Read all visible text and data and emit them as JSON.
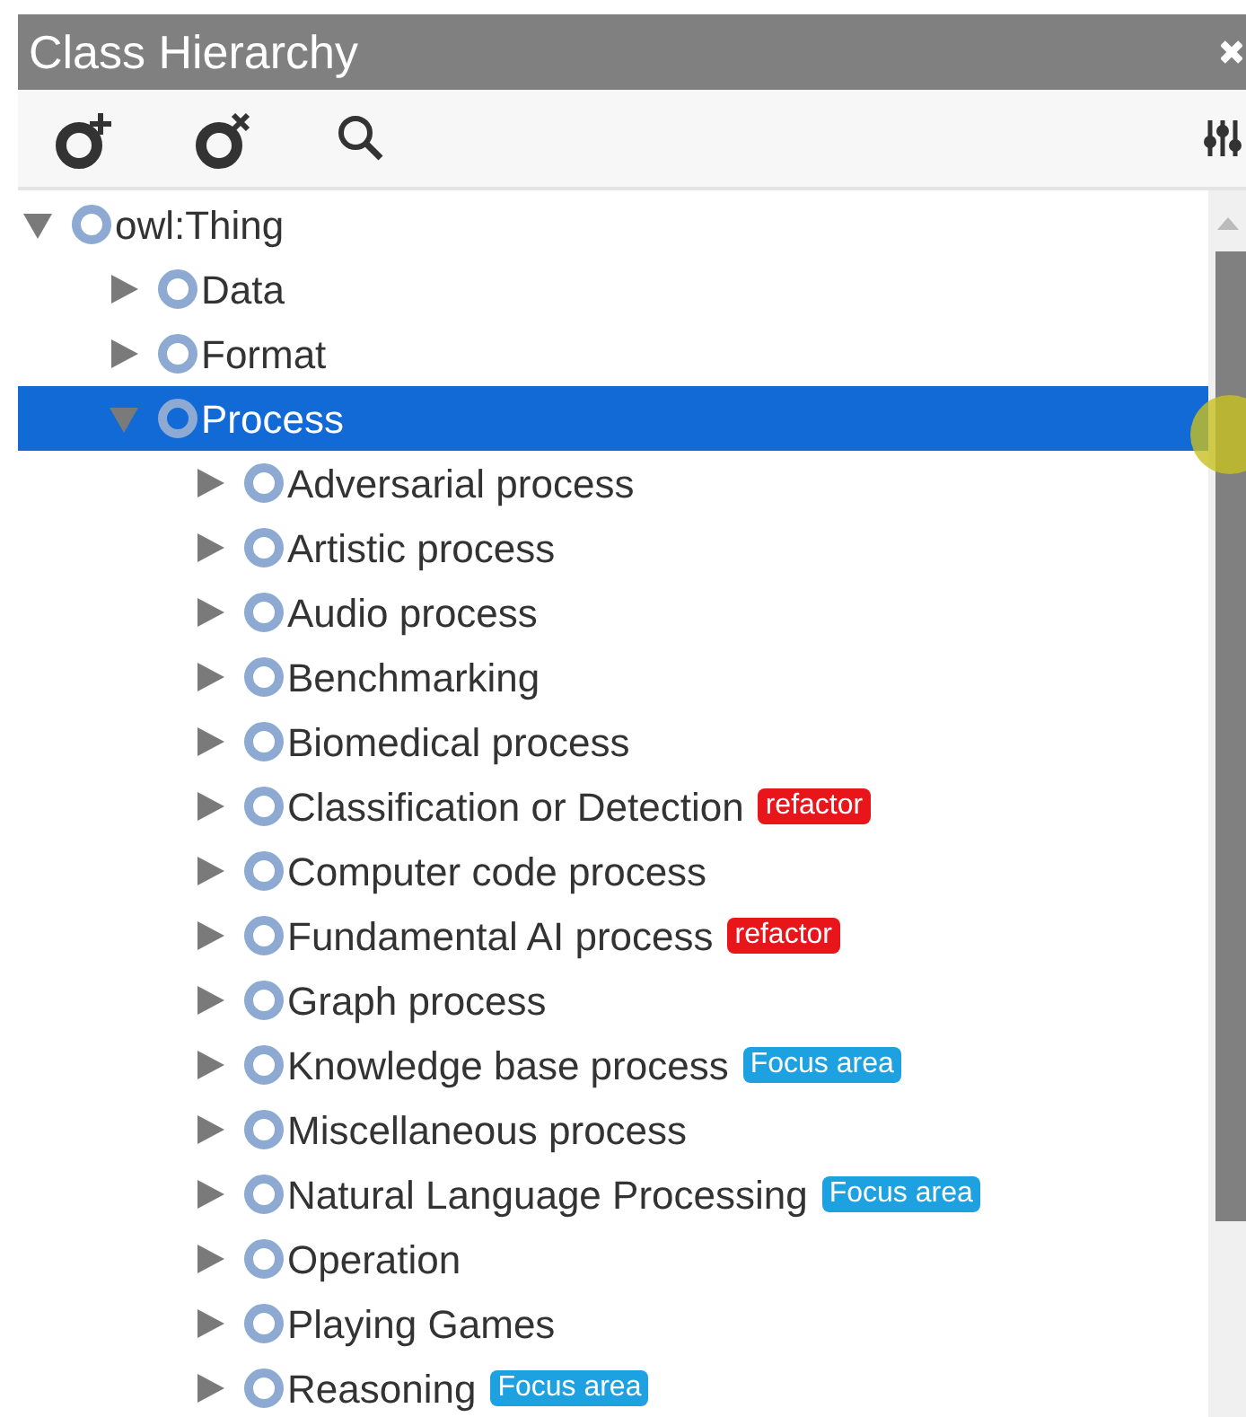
{
  "panel": {
    "title": "Class Hierarchy"
  },
  "tree": [
    {
      "label": "owl:Thing",
      "expanded": true,
      "selected": false,
      "children": [
        {
          "label": "Data",
          "expanded": false,
          "selected": false
        },
        {
          "label": "Format",
          "expanded": false,
          "selected": false
        },
        {
          "label": "Process",
          "expanded": true,
          "selected": true,
          "children": [
            {
              "label": "Adversarial process",
              "expanded": false,
              "selected": false
            },
            {
              "label": "Artistic process",
              "expanded": false,
              "selected": false
            },
            {
              "label": "Audio process",
              "expanded": false,
              "selected": false
            },
            {
              "label": "Benchmarking",
              "expanded": false,
              "selected": false
            },
            {
              "label": "Biomedical process",
              "expanded": false,
              "selected": false
            },
            {
              "label": "Classification or Detection",
              "expanded": false,
              "selected": false,
              "tag": {
                "text": "refactor",
                "color": "#e8161b"
              }
            },
            {
              "label": "Computer code process",
              "expanded": false,
              "selected": false
            },
            {
              "label": "Fundamental AI process",
              "expanded": false,
              "selected": false,
              "tag": {
                "text": "refactor",
                "color": "#e8161b"
              }
            },
            {
              "label": "Graph process",
              "expanded": false,
              "selected": false
            },
            {
              "label": "Knowledge base process",
              "expanded": false,
              "selected": false,
              "tag": {
                "text": "Focus area",
                "color": "#1ea1e0"
              }
            },
            {
              "label": "Miscellaneous process",
              "expanded": false,
              "selected": false
            },
            {
              "label": "Natural Language Processing",
              "expanded": false,
              "selected": false,
              "tag": {
                "text": "Focus area",
                "color": "#1ea1e0"
              }
            },
            {
              "label": "Operation",
              "expanded": false,
              "selected": false
            },
            {
              "label": "Playing Games",
              "expanded": false,
              "selected": false
            },
            {
              "label": "Reasoning",
              "expanded": false,
              "selected": false,
              "tag": {
                "text": "Focus area",
                "color": "#1ea1e0"
              }
            }
          ]
        }
      ]
    }
  ]
}
